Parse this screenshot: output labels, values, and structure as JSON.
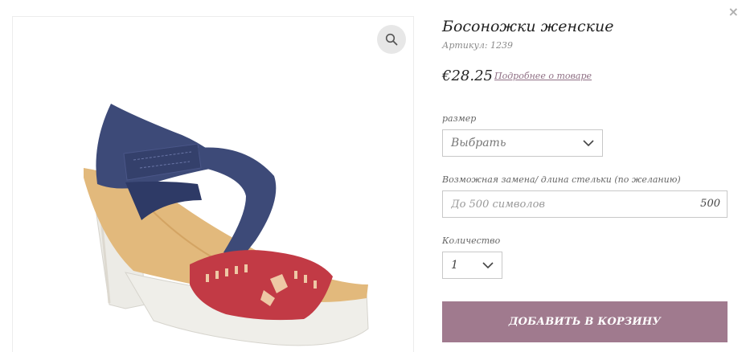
{
  "product": {
    "title": "Босоножки женские",
    "sku": "Артикул: 1239",
    "price": "€28.25",
    "more_link": "Подробнее о товаре"
  },
  "image": {
    "alt": "Босоножки женские",
    "zoom_icon": "magnifier-icon"
  },
  "close_icon": "close-icon",
  "close_label": "×",
  "size": {
    "label": "размер",
    "selected": "Выбрать"
  },
  "note": {
    "label": "Возможная замена/ длина стельки (по желанию)",
    "placeholder": "До 500 символов",
    "value": "",
    "counter": "500"
  },
  "quantity": {
    "label": "Количество",
    "selected": "1"
  },
  "add_to_cart": {
    "label": "ДОБАВИТЬ В КОРЗИНУ",
    "color": "#a07a8e"
  }
}
